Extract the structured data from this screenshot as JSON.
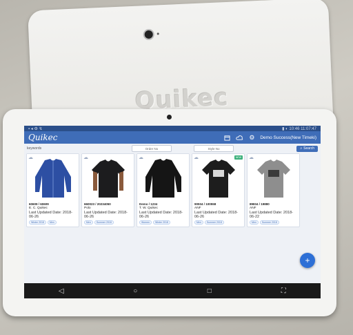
{
  "back_tablet": {
    "logo": "Quikec"
  },
  "status_bar": {
    "left_icons": "▪ ◂ ⚙ ↯",
    "right_text": "▮ ◐  10:46  11:07:47"
  },
  "app_bar": {
    "logo": "Quikec",
    "user": "Demo Success(New Timeki)"
  },
  "filter_bar": {
    "keywords": "keywords",
    "type_placeholder": "Order No",
    "style_placeholder": "Style No",
    "search_label": "Search"
  },
  "cards": [
    {
      "id": "60609 / 60609",
      "brand": "E. C. Quikec",
      "date": "Last Updated Date: 2018-06-26",
      "tags": [
        "Winter 2018",
        "Men"
      ],
      "badge": "",
      "shirt": "#2d4fa3",
      "kind": "jacket"
    },
    {
      "id": "660023 / 20234050",
      "brand": "Polo",
      "date": "Last Updated Date: 2018-06-26",
      "tags": [
        "Men",
        "Summer 2018"
      ],
      "badge": "",
      "shirt": "#1c1c1e",
      "kind": "tee-model"
    },
    {
      "id": "Demo / 1234",
      "brand": "T. W. Quikec",
      "date": "Last Updated Date: 2018-06-26",
      "tags": [
        "Women",
        "Winter 2018"
      ],
      "badge": "",
      "shirt": "#151515",
      "kind": "long"
    },
    {
      "id": "90934 / 100558",
      "brand": "ANF",
      "date": "Last Updated Date: 2018-06-26",
      "tags": [
        "Men",
        "Summer 2018"
      ],
      "badge": "NEW",
      "shirt": "#1d1d1d",
      "kind": "tee-print"
    },
    {
      "id": "89834 / 19880",
      "brand": "ANF",
      "date": "Last Updated Date: 2018-06-22",
      "tags": [
        "Men",
        "Summer 2018"
      ],
      "badge": "",
      "shirt": "#8e8e8e",
      "kind": "tee-print"
    }
  ],
  "fab": {
    "label": "+"
  },
  "nav": {
    "back": "◁",
    "home": "○",
    "recent": "□",
    "screenshot": "⛶"
  }
}
